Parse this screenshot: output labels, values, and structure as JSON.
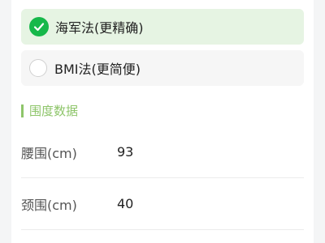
{
  "options": [
    {
      "label": "海军法(更精确)",
      "selected": true
    },
    {
      "label": "BMI法(更简便)",
      "selected": false
    }
  ],
  "section": {
    "title": "围度数据"
  },
  "fields": [
    {
      "label": "腰围(cm)",
      "value": "93"
    },
    {
      "label": "颈围(cm)",
      "value": "40"
    }
  ],
  "colors": {
    "accent": "#16b84a",
    "section": "#8ec56a",
    "selected_bg": "#e6f4e3"
  }
}
